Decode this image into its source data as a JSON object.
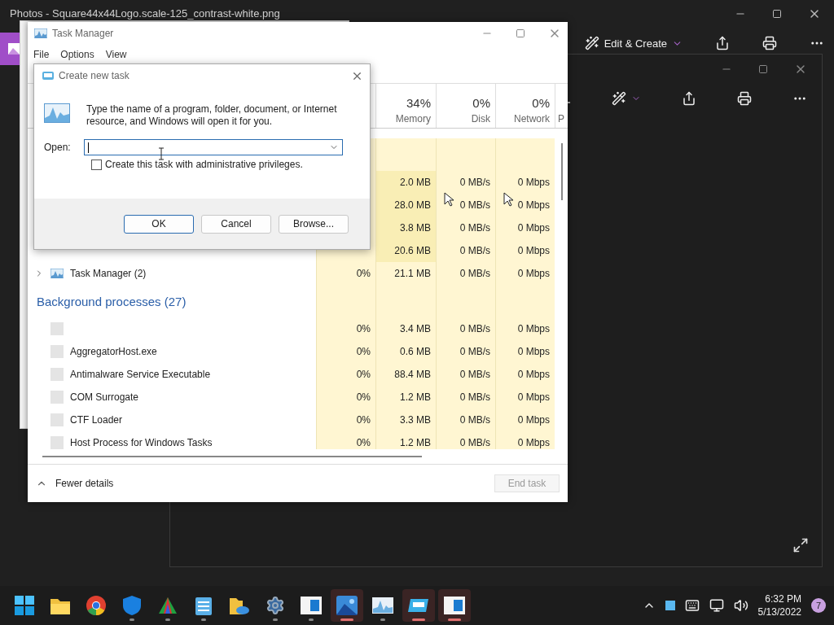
{
  "photos_window": {
    "title": "Photos - Square44x44Logo.scale-125_contrast-white.png",
    "toolbar_label": "Edit & Create"
  },
  "task_manager": {
    "title": "Task Manager",
    "menu": [
      "File",
      "Options",
      "View"
    ],
    "columns": [
      {
        "percent": "34%",
        "label": "Memory"
      },
      {
        "percent": "0%",
        "label": "Disk"
      },
      {
        "percent": "0%",
        "label": "Network"
      },
      {
        "label": "P"
      }
    ],
    "rows": [
      {
        "kind": "group"
      },
      {
        "kind": "covered",
        "memory": "2.0 MB",
        "disk": "0 MB/s",
        "network": "0 Mbps"
      },
      {
        "kind": "covered",
        "memory": "28.0 MB",
        "disk": "0 MB/s",
        "network": "0 Mbps"
      },
      {
        "kind": "covered",
        "memory": "3.8 MB",
        "disk": "0 MB/s",
        "network": "0 Mbps"
      },
      {
        "kind": "covered",
        "memory": "20.6 MB",
        "disk": "0 MB/s",
        "network": "0 Mbps"
      },
      {
        "kind": "app",
        "expandable": true,
        "name": "Task Manager (2)",
        "cpu": "0%",
        "memory": "21.1 MB",
        "disk": "0 MB/s",
        "network": "0 Mbps"
      },
      {
        "kind": "group",
        "name": "Background processes (27)"
      },
      {
        "kind": "background",
        "expandable": false,
        "cpu": "0%",
        "memory": "3.4 MB",
        "disk": "0 MB/s",
        "network": "0 Mbps"
      },
      {
        "kind": "background",
        "expandable": false,
        "name": "AggregatorHost.exe",
        "cpu": "0%",
        "memory": "0.6 MB",
        "disk": "0 MB/s",
        "network": "0 Mbps"
      },
      {
        "kind": "background",
        "expandable": false,
        "name": "Antimalware Service Executable",
        "cpu": "0%",
        "memory": "88.4 MB",
        "disk": "0 MB/s",
        "network": "0 Mbps"
      },
      {
        "kind": "background",
        "expandable": false,
        "name": "COM Surrogate",
        "cpu": "0%",
        "memory": "1.2 MB",
        "disk": "0 MB/s",
        "network": "0 Mbps"
      },
      {
        "kind": "background",
        "expandable": false,
        "name": "CTF Loader",
        "cpu": "0%",
        "memory": "3.3 MB",
        "disk": "0 MB/s",
        "network": "0 Mbps"
      },
      {
        "kind": "background",
        "expandable": false,
        "name": "Host Process for Windows Tasks",
        "cpu": "0%",
        "memory": "1.2 MB",
        "disk": "0 MB/s",
        "network": "0 Mbps"
      }
    ],
    "footer": {
      "toggle": "Fewer details",
      "end_task": {
        "label": "End task",
        "disabled": true
      }
    }
  },
  "dialog": {
    "title": "Create new task",
    "message": "Type the name of a program, folder, document, or Internet resource, and Windows will open it for you.",
    "open_label": "Open:",
    "admin_checkbox": {
      "label": "Create this task with administrative privileges.",
      "checked": false
    },
    "buttons": [
      {
        "label": "OK",
        "selected": true
      },
      {
        "label": "Cancel",
        "selected": false
      },
      {
        "label": "Browse...",
        "selected": false
      }
    ]
  },
  "taskbar": {
    "apps": [
      {
        "kind": "start",
        "running": false,
        "active": false
      },
      {
        "kind": "folder",
        "running": false,
        "active": false
      },
      {
        "kind": "browser",
        "running": false,
        "active": false
      },
      {
        "kind": "shield",
        "running": true,
        "active": false
      },
      {
        "kind": "prism",
        "running": true,
        "active": false
      },
      {
        "kind": "notepad",
        "running": true,
        "active": false
      },
      {
        "kind": "cloud-folder",
        "running": false,
        "active": false
      },
      {
        "kind": "gear",
        "running": true,
        "active": false
      },
      {
        "kind": "window",
        "running": true,
        "active": false
      },
      {
        "kind": "landscape",
        "running": true,
        "active": true
      },
      {
        "kind": "chart",
        "running": true,
        "active": false
      },
      {
        "kind": "drive",
        "running": true,
        "active": true
      },
      {
        "kind": "window",
        "running": true,
        "active": true
      }
    ],
    "time": "6:32 PM",
    "date": "5/13/2022",
    "notifications": "7"
  }
}
